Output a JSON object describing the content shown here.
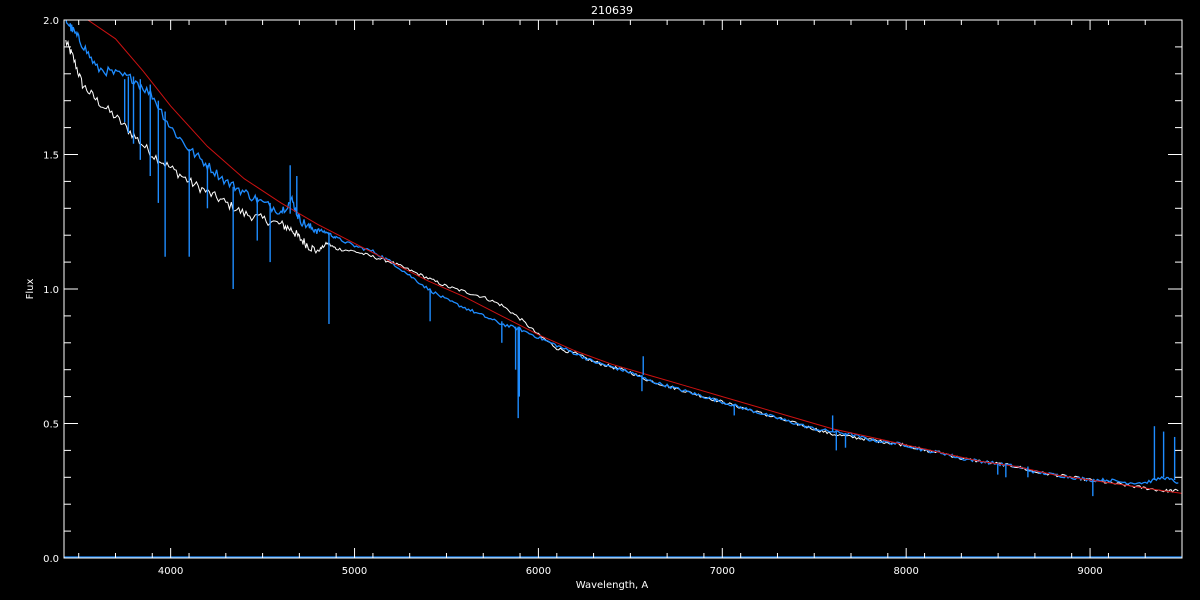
{
  "chart_data": {
    "type": "line",
    "title": "210639",
    "xlabel": "Wavelength, A",
    "ylabel": "Flux",
    "xlim": [
      3420,
      9500
    ],
    "ylim": [
      0.0,
      2.0
    ],
    "x_ticks": [
      4000,
      5000,
      6000,
      7000,
      8000,
      9000
    ],
    "x_tick_labels": [
      "4000",
      "5000",
      "6000",
      "7000",
      "8000",
      "9000"
    ],
    "y_ticks": [
      0.0,
      0.5,
      1.0,
      1.5,
      2.0
    ],
    "y_tick_labels": [
      "0.0",
      "0.5",
      "1.0",
      "1.5",
      "2.0"
    ],
    "background": "#000000",
    "axis_color": "#ffffff",
    "series": [
      {
        "color": "#ffffff",
        "x": [
          3430,
          3470,
          3520,
          3600,
          3700,
          3800,
          3900,
          4000,
          4100,
          4200,
          4300,
          4400,
          4500,
          4600,
          4660,
          4700,
          4750,
          4800,
          4850,
          4900,
          5000,
          5100,
          5200,
          5300,
          5400,
          5500,
          5600,
          5700,
          5800,
          5900,
          6000,
          6100,
          6200,
          6300,
          6400,
          6500,
          6600,
          6700,
          6800,
          6900,
          7000,
          7100,
          7200,
          7300,
          7400,
          7500,
          7600,
          7700,
          7800,
          7900,
          8000,
          8100,
          8200,
          8300,
          8400,
          8500,
          8600,
          8700,
          8800,
          8900,
          9000,
          9100,
          9200,
          9300,
          9400,
          9480
        ],
        "y": [
          1.92,
          1.86,
          1.76,
          1.7,
          1.64,
          1.57,
          1.5,
          1.45,
          1.4,
          1.36,
          1.32,
          1.28,
          1.26,
          1.24,
          1.22,
          1.19,
          1.16,
          1.14,
          1.17,
          1.15,
          1.14,
          1.12,
          1.1,
          1.07,
          1.04,
          1.01,
          0.99,
          0.97,
          0.94,
          0.89,
          0.83,
          0.78,
          0.76,
          0.73,
          0.71,
          0.69,
          0.66,
          0.64,
          0.62,
          0.6,
          0.58,
          0.56,
          0.54,
          0.52,
          0.5,
          0.48,
          0.46,
          0.45,
          0.44,
          0.43,
          0.42,
          0.4,
          0.39,
          0.37,
          0.36,
          0.35,
          0.34,
          0.32,
          0.31,
          0.3,
          0.29,
          0.28,
          0.27,
          0.26,
          0.25,
          0.25
        ]
      },
      {
        "color": "#1e8cff",
        "x": [
          3430,
          3470,
          3520,
          3600,
          3700,
          3800,
          3900,
          4000,
          4100,
          4200,
          4300,
          4400,
          4500,
          4600,
          4660,
          4700,
          4750,
          4800,
          4850,
          4900,
          5000,
          5100,
          5200,
          5300,
          5400,
          5500,
          5600,
          5700,
          5800,
          5900,
          6000,
          6100,
          6200,
          6300,
          6400,
          6500,
          6600,
          6700,
          6800,
          6900,
          7000,
          7100,
          7200,
          7300,
          7400,
          7500,
          7600,
          7700,
          7800,
          7900,
          8000,
          8100,
          8200,
          8300,
          8400,
          8500,
          8600,
          8700,
          8800,
          8900,
          9000,
          9100,
          9200,
          9300,
          9400,
          9480
        ],
        "y": [
          2.0,
          1.96,
          1.91,
          1.82,
          1.8,
          1.78,
          1.72,
          1.6,
          1.52,
          1.46,
          1.4,
          1.36,
          1.32,
          1.29,
          1.33,
          1.26,
          1.23,
          1.22,
          1.21,
          1.19,
          1.16,
          1.14,
          1.1,
          1.05,
          1.0,
          0.96,
          0.93,
          0.9,
          0.87,
          0.85,
          0.82,
          0.79,
          0.76,
          0.73,
          0.71,
          0.69,
          0.66,
          0.64,
          0.62,
          0.6,
          0.58,
          0.56,
          0.54,
          0.52,
          0.5,
          0.48,
          0.47,
          0.46,
          0.44,
          0.43,
          0.42,
          0.4,
          0.39,
          0.37,
          0.36,
          0.35,
          0.34,
          0.32,
          0.31,
          0.3,
          0.29,
          0.29,
          0.28,
          0.28,
          0.3,
          0.28
        ]
      },
      {
        "color": "#cc1111",
        "x": [
          3430,
          3550,
          3700,
          3850,
          4000,
          4200,
          4400,
          4600,
          4800,
          5000,
          5200,
          5400,
          5600,
          5800,
          6000,
          6200,
          6400,
          6600,
          6800,
          7000,
          7200,
          7400,
          7600,
          7800,
          8000,
          8200,
          8400,
          8600,
          8800,
          9000,
          9200,
          9400,
          9500
        ],
        "y": [
          2.02,
          2.0,
          1.93,
          1.81,
          1.68,
          1.53,
          1.41,
          1.32,
          1.24,
          1.17,
          1.1,
          1.03,
          0.97,
          0.9,
          0.83,
          0.77,
          0.72,
          0.68,
          0.64,
          0.6,
          0.56,
          0.52,
          0.48,
          0.45,
          0.42,
          0.39,
          0.36,
          0.34,
          0.31,
          0.29,
          0.27,
          0.25,
          0.24
        ]
      }
    ],
    "absorption_lines": {
      "color": "#1e8cff",
      "items": [
        {
          "x": 3750,
          "y_top": 1.78,
          "y_min": 1.62
        },
        {
          "x": 3770,
          "y_top": 1.79,
          "y_min": 1.58
        },
        {
          "x": 3798,
          "y_top": 1.79,
          "y_min": 1.54
        },
        {
          "x": 3835,
          "y_top": 1.78,
          "y_min": 1.48
        },
        {
          "x": 3889,
          "y_top": 1.76,
          "y_min": 1.42
        },
        {
          "x": 3933,
          "y_top": 1.7,
          "y_min": 1.32
        },
        {
          "x": 3970,
          "y_top": 1.66,
          "y_min": 1.12
        },
        {
          "x": 4101,
          "y_top": 1.52,
          "y_min": 1.12
        },
        {
          "x": 4200,
          "y_top": 1.46,
          "y_min": 1.3
        },
        {
          "x": 4340,
          "y_top": 1.38,
          "y_min": 1.0
        },
        {
          "x": 4471,
          "y_top": 1.34,
          "y_min": 1.18
        },
        {
          "x": 4541,
          "y_top": 1.32,
          "y_min": 1.1
        },
        {
          "x": 4861,
          "y_top": 1.21,
          "y_min": 0.87
        },
        {
          "x": 5411,
          "y_top": 1.0,
          "y_min": 0.88
        },
        {
          "x": 5801,
          "y_top": 0.88,
          "y_min": 0.8
        },
        {
          "x": 5876,
          "y_top": 0.86,
          "y_min": 0.7
        },
        {
          "x": 5890,
          "y_top": 0.86,
          "y_min": 0.52
        },
        {
          "x": 5896,
          "y_top": 0.86,
          "y_min": 0.6
        },
        {
          "x": 6563,
          "y_top": 0.68,
          "y_min": 0.62
        },
        {
          "x": 7065,
          "y_top": 0.57,
          "y_min": 0.53
        },
        {
          "x": 7620,
          "y_top": 0.47,
          "y_min": 0.4
        },
        {
          "x": 7670,
          "y_top": 0.46,
          "y_min": 0.41
        },
        {
          "x": 8498,
          "y_top": 0.35,
          "y_min": 0.31
        },
        {
          "x": 8542,
          "y_top": 0.35,
          "y_min": 0.3
        },
        {
          "x": 8662,
          "y_top": 0.34,
          "y_min": 0.3
        },
        {
          "x": 9015,
          "y_top": 0.29,
          "y_min": 0.23
        }
      ]
    },
    "emission_spikes": {
      "color": "#1e8cff",
      "items": [
        {
          "x": 4650,
          "y_base": 1.28,
          "y_peak": 1.46
        },
        {
          "x": 4686,
          "y_base": 1.27,
          "y_peak": 1.42
        },
        {
          "x": 6570,
          "y_base": 0.68,
          "y_peak": 0.75
        },
        {
          "x": 7600,
          "y_base": 0.47,
          "y_peak": 0.53
        },
        {
          "x": 9350,
          "y_base": 0.29,
          "y_peak": 0.49
        },
        {
          "x": 9400,
          "y_base": 0.3,
          "y_peak": 0.47
        },
        {
          "x": 9460,
          "y_base": 0.29,
          "y_peak": 0.45
        }
      ]
    },
    "baseline_series": {
      "color": "#1e8cff",
      "y": 0.0
    }
  }
}
